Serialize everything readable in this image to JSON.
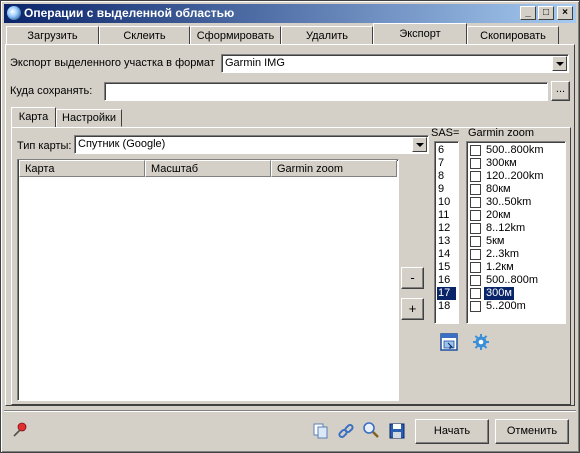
{
  "window": {
    "title": "Операции с выделенной областью",
    "min": "_",
    "max": "□",
    "close": "×"
  },
  "top_tabs": [
    "Загрузить",
    "Склеить",
    "Сформировать",
    "Удалить",
    "Экспорт",
    "Скопировать"
  ],
  "active_top_tab": 4,
  "export": {
    "format_label": "Экспорт выделенного участка в формат",
    "format_value": "Garmin IMG"
  },
  "save": {
    "label": "Куда сохранять:",
    "path": "",
    "browse": "..."
  },
  "inner_tabs": [
    "Карта",
    "Настройки"
  ],
  "map_type": {
    "label": "Тип карты:",
    "value": "Спутник (Google)"
  },
  "table": {
    "headers": [
      "Карта",
      "Масштаб",
      "Garmin zoom"
    ],
    "rows": []
  },
  "side_buttons": {
    "remove": "-",
    "add": "+"
  },
  "sas": {
    "label": "SAS=",
    "values": [
      "6",
      "7",
      "8",
      "9",
      "10",
      "11",
      "12",
      "13",
      "14",
      "15",
      "16",
      "17",
      "18"
    ],
    "selected": 11
  },
  "garmin_zoom": {
    "label": "Garmin zoom",
    "values": [
      "500..800km",
      "300км",
      "120..200km",
      "80км",
      "30..50km",
      "20км",
      "8..12km",
      "5км",
      "2..3km",
      "1.2км",
      "500..800m",
      "300м",
      "5..200m"
    ],
    "selected": 11
  },
  "footer": {
    "start": "Начать",
    "cancel": "Отменить"
  },
  "icons": [
    "pin-icon",
    "copy-icon",
    "link-icon",
    "zoom-icon",
    "save-icon",
    "map-settings-icon",
    "gear-icon"
  ],
  "colors": {
    "title_start": "#0a246a",
    "title_end": "#a6caf0",
    "selection": "#0a246a",
    "face": "#d4d0c8"
  }
}
